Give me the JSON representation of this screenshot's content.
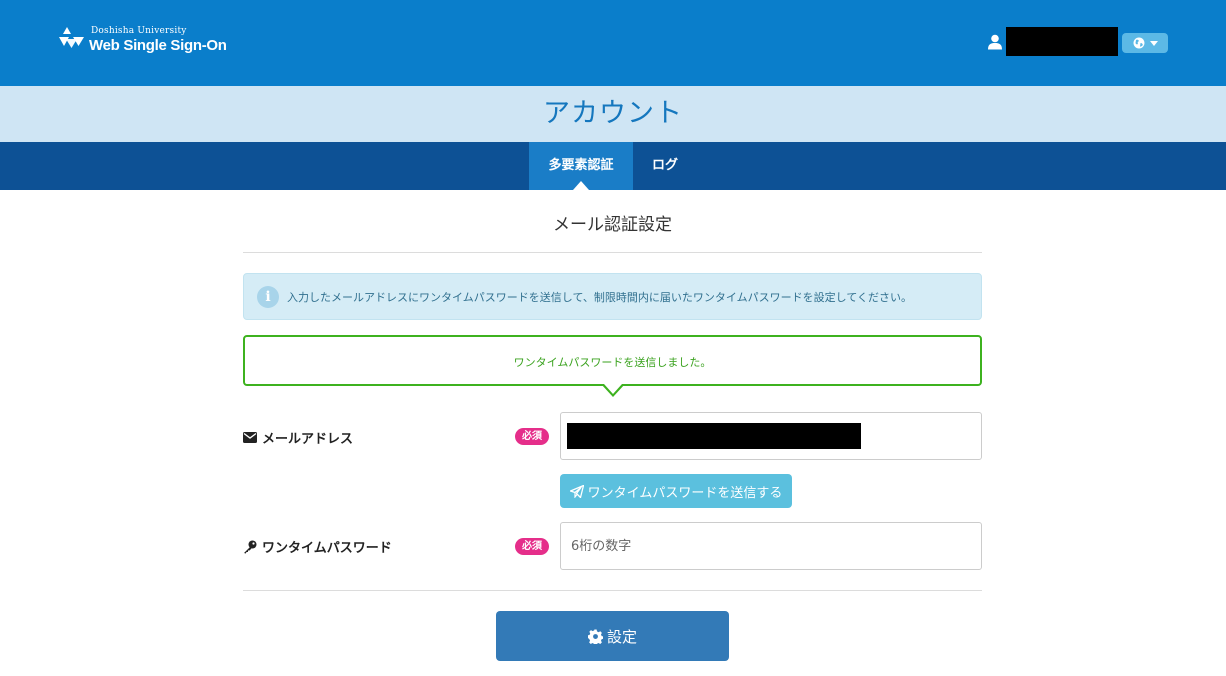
{
  "header": {
    "logo_small": "Doshisha University",
    "logo_big": "Web Single Sign-On",
    "user_name": "",
    "icons": [
      "user-icon",
      "globe-icon",
      "caret-down-icon"
    ]
  },
  "page": {
    "title": "アカウント"
  },
  "tabs": [
    {
      "label": "多要素認証",
      "active": true
    },
    {
      "label": "ログ",
      "active": false
    }
  ],
  "section": {
    "title": "メール認証設定"
  },
  "info_alert": {
    "icon": "info-icon",
    "text": "入力したメールアドレスにワンタイムパスワードを送信して、制限時間内に届いたワンタイムパスワードを設定してください。"
  },
  "success_alert": {
    "text": "ワンタイムパスワードを送信しました。"
  },
  "form": {
    "email": {
      "label": "メールアドレス",
      "required_badge": "必須",
      "value": "",
      "icon": "envelope-icon"
    },
    "send_button": {
      "label": "ワンタイムパスワードを送信する",
      "icon": "paper-plane-icon"
    },
    "otp": {
      "label": "ワンタイムパスワード",
      "required_badge": "必須",
      "placeholder": "6桁の数字",
      "value": "",
      "icon": "key-icon"
    },
    "submit_button": {
      "label": "設定",
      "icon": "gear-icon"
    }
  },
  "colors": {
    "header_bg": "#0a7ecb",
    "title_band_bg": "#cfe5f4",
    "tabbar_bg": "#0d5195",
    "active_tab_bg": "#1a7dc7",
    "success_border": "#3db21f",
    "required_badge": "#e52e8a",
    "send_button": "#5bc0de",
    "submit_button": "#337ab7"
  }
}
